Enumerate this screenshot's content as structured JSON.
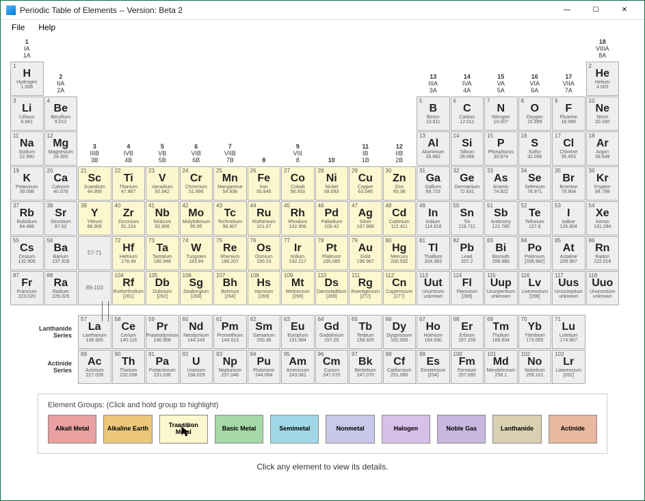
{
  "window": {
    "title": "Periodic Table of Elements  -- Version: Beta 2",
    "min": "—",
    "max": "☐",
    "close": "✕"
  },
  "menu": {
    "file": "File",
    "help": "Help"
  },
  "group_headers": [
    {
      "col": 1,
      "lines": [
        "1",
        "IA",
        "1A"
      ]
    },
    {
      "col": 2,
      "lines": [
        "2",
        "IIA",
        "2A"
      ]
    },
    {
      "col": 3,
      "lines": [
        "3",
        "IIIB",
        "3B"
      ]
    },
    {
      "col": 4,
      "lines": [
        "4",
        "IVB",
        "4B"
      ]
    },
    {
      "col": 5,
      "lines": [
        "5",
        "VB",
        "5B"
      ]
    },
    {
      "col": 6,
      "lines": [
        "6",
        "VIB",
        "6B"
      ]
    },
    {
      "col": 7,
      "lines": [
        "7",
        "VIIB",
        "7B"
      ]
    },
    {
      "col": 8,
      "lines": [
        "8",
        "",
        ""
      ]
    },
    {
      "col": 9,
      "lines": [
        "9",
        "VIII",
        "8"
      ]
    },
    {
      "col": 10,
      "lines": [
        "10",
        "",
        ""
      ]
    },
    {
      "col": 11,
      "lines": [
        "11",
        "IB",
        "1B"
      ]
    },
    {
      "col": 12,
      "lines": [
        "12",
        "IIB",
        "2B"
      ]
    },
    {
      "col": 13,
      "lines": [
        "13",
        "IIIA",
        "3A"
      ]
    },
    {
      "col": 14,
      "lines": [
        "14",
        "IVA",
        "4A"
      ]
    },
    {
      "col": 15,
      "lines": [
        "15",
        "VA",
        "5A"
      ]
    },
    {
      "col": 16,
      "lines": [
        "16",
        "VIA",
        "6A"
      ]
    },
    {
      "col": 17,
      "lines": [
        "17",
        "VIIA",
        "7A"
      ]
    },
    {
      "col": 18,
      "lines": [
        "18",
        "VIIIA",
        "8A"
      ]
    }
  ],
  "elements": [
    {
      "n": 1,
      "s": "H",
      "nm": "Hydrogen",
      "m": "1.008",
      "r": 1,
      "c": 1,
      "g": ""
    },
    {
      "n": 2,
      "s": "He",
      "nm": "Helium",
      "m": "4.003",
      "r": 1,
      "c": 18,
      "g": ""
    },
    {
      "n": 3,
      "s": "Li",
      "nm": "Lithium",
      "m": "6.941",
      "r": 2,
      "c": 1,
      "g": ""
    },
    {
      "n": 4,
      "s": "Be",
      "nm": "Beryllium",
      "m": "9.012",
      "r": 2,
      "c": 2,
      "g": ""
    },
    {
      "n": 5,
      "s": "B",
      "nm": "Boron",
      "m": "10.811",
      "r": 2,
      "c": 13,
      "g": ""
    },
    {
      "n": 6,
      "s": "C",
      "nm": "Carbon",
      "m": "12.011",
      "r": 2,
      "c": 14,
      "g": ""
    },
    {
      "n": 7,
      "s": "N",
      "nm": "Nitrogen",
      "m": "14.007",
      "r": 2,
      "c": 15,
      "g": ""
    },
    {
      "n": 8,
      "s": "O",
      "nm": "Oxygen",
      "m": "15.999",
      "r": 2,
      "c": 16,
      "g": ""
    },
    {
      "n": 9,
      "s": "F",
      "nm": "Fluorine",
      "m": "18.998",
      "r": 2,
      "c": 17,
      "g": ""
    },
    {
      "n": 10,
      "s": "Ne",
      "nm": "Neon",
      "m": "20.180",
      "r": 2,
      "c": 18,
      "g": ""
    },
    {
      "n": 11,
      "s": "Na",
      "nm": "Sodium",
      "m": "22.990",
      "r": 3,
      "c": 1,
      "g": ""
    },
    {
      "n": 12,
      "s": "Mg",
      "nm": "Magnesium",
      "m": "24.305",
      "r": 3,
      "c": 2,
      "g": ""
    },
    {
      "n": 13,
      "s": "Al",
      "nm": "Aluminium",
      "m": "26.982",
      "r": 3,
      "c": 13,
      "g": ""
    },
    {
      "n": 14,
      "s": "Si",
      "nm": "Silicon",
      "m": "28.086",
      "r": 3,
      "c": 14,
      "g": ""
    },
    {
      "n": 15,
      "s": "P",
      "nm": "Phosphorus",
      "m": "30.974",
      "r": 3,
      "c": 15,
      "g": ""
    },
    {
      "n": 16,
      "s": "S",
      "nm": "Sulfur",
      "m": "32.066",
      "r": 3,
      "c": 16,
      "g": ""
    },
    {
      "n": 17,
      "s": "Cl",
      "nm": "Chlorine",
      "m": "35.453",
      "r": 3,
      "c": 17,
      "g": ""
    },
    {
      "n": 18,
      "s": "Ar",
      "nm": "Argon",
      "m": "39.948",
      "r": 3,
      "c": 18,
      "g": ""
    },
    {
      "n": 19,
      "s": "K",
      "nm": "Potassium",
      "m": "39.098",
      "r": 4,
      "c": 1,
      "g": ""
    },
    {
      "n": 20,
      "s": "Ca",
      "nm": "Calcium",
      "m": "40.078",
      "r": 4,
      "c": 2,
      "g": ""
    },
    {
      "n": 21,
      "s": "Sc",
      "nm": "Scandium",
      "m": "44.956",
      "r": 4,
      "c": 3,
      "g": "tm"
    },
    {
      "n": 22,
      "s": "Ti",
      "nm": "Titanium",
      "m": "47.867",
      "r": 4,
      "c": 4,
      "g": "tm"
    },
    {
      "n": 23,
      "s": "V",
      "nm": "Vanadium",
      "m": "50.942",
      "r": 4,
      "c": 5,
      "g": "tm"
    },
    {
      "n": 24,
      "s": "Cr",
      "nm": "Chromium",
      "m": "51.996",
      "r": 4,
      "c": 6,
      "g": "tm"
    },
    {
      "n": 25,
      "s": "Mn",
      "nm": "Manganese",
      "m": "54.938",
      "r": 4,
      "c": 7,
      "g": "tm"
    },
    {
      "n": 26,
      "s": "Fe",
      "nm": "Iron",
      "m": "55.845",
      "r": 4,
      "c": 8,
      "g": "tm"
    },
    {
      "n": 27,
      "s": "Co",
      "nm": "Cobalt",
      "m": "58.933",
      "r": 4,
      "c": 9,
      "g": "tm"
    },
    {
      "n": 28,
      "s": "Ni",
      "nm": "Nickel",
      "m": "58.693",
      "r": 4,
      "c": 10,
      "g": "tm"
    },
    {
      "n": 29,
      "s": "Cu",
      "nm": "Copper",
      "m": "63.546",
      "r": 4,
      "c": 11,
      "g": "tm"
    },
    {
      "n": 30,
      "s": "Zn",
      "nm": "Zinc",
      "m": "65.38",
      "r": 4,
      "c": 12,
      "g": "tm"
    },
    {
      "n": 31,
      "s": "Ga",
      "nm": "Gallium",
      "m": "69.723",
      "r": 4,
      "c": 13,
      "g": ""
    },
    {
      "n": 32,
      "s": "Ge",
      "nm": "Germanium",
      "m": "72.631",
      "r": 4,
      "c": 14,
      "g": ""
    },
    {
      "n": 33,
      "s": "As",
      "nm": "Arsenic",
      "m": "74.922",
      "r": 4,
      "c": 15,
      "g": ""
    },
    {
      "n": 34,
      "s": "Se",
      "nm": "Selenium",
      "m": "78.971",
      "r": 4,
      "c": 16,
      "g": ""
    },
    {
      "n": 35,
      "s": "Br",
      "nm": "Bromine",
      "m": "79.904",
      "r": 4,
      "c": 17,
      "g": ""
    },
    {
      "n": 36,
      "s": "Kr",
      "nm": "Krypton",
      "m": "84.798",
      "r": 4,
      "c": 18,
      "g": ""
    },
    {
      "n": 37,
      "s": "Rb",
      "nm": "Rubidium",
      "m": "84.468",
      "r": 5,
      "c": 1,
      "g": ""
    },
    {
      "n": 38,
      "s": "Sr",
      "nm": "Strontium",
      "m": "87.62",
      "r": 5,
      "c": 2,
      "g": ""
    },
    {
      "n": 39,
      "s": "Y",
      "nm": "Yttrium",
      "m": "88.906",
      "r": 5,
      "c": 3,
      "g": "tm"
    },
    {
      "n": 40,
      "s": "Zr",
      "nm": "Zirconium",
      "m": "91.224",
      "r": 5,
      "c": 4,
      "g": "tm"
    },
    {
      "n": 41,
      "s": "Nb",
      "nm": "Niobium",
      "m": "92.906",
      "r": 5,
      "c": 5,
      "g": "tm"
    },
    {
      "n": 42,
      "s": "Mo",
      "nm": "Molybdenum",
      "m": "95.95",
      "r": 5,
      "c": 6,
      "g": "tm"
    },
    {
      "n": 43,
      "s": "Tc",
      "nm": "Technetium",
      "m": "98.907",
      "r": 5,
      "c": 7,
      "g": "tm"
    },
    {
      "n": 44,
      "s": "Ru",
      "nm": "Ruthenium",
      "m": "101.07",
      "r": 5,
      "c": 8,
      "g": "tm"
    },
    {
      "n": 45,
      "s": "Rh",
      "nm": "Rhodium",
      "m": "102.906",
      "r": 5,
      "c": 9,
      "g": "tm"
    },
    {
      "n": 46,
      "s": "Pd",
      "nm": "Palladium",
      "m": "106.42",
      "r": 5,
      "c": 10,
      "g": "tm"
    },
    {
      "n": 47,
      "s": "Ag",
      "nm": "Silver",
      "m": "107.868",
      "r": 5,
      "c": 11,
      "g": "tm"
    },
    {
      "n": 48,
      "s": "Cd",
      "nm": "Cadmium",
      "m": "112.411",
      "r": 5,
      "c": 12,
      "g": "tm"
    },
    {
      "n": 49,
      "s": "In",
      "nm": "Indium",
      "m": "114.818",
      "r": 5,
      "c": 13,
      "g": ""
    },
    {
      "n": 50,
      "s": "Sn",
      "nm": "Tin",
      "m": "118.711",
      "r": 5,
      "c": 14,
      "g": ""
    },
    {
      "n": 51,
      "s": "Sb",
      "nm": "Antimony",
      "m": "121.760",
      "r": 5,
      "c": 15,
      "g": ""
    },
    {
      "n": 52,
      "s": "Te",
      "nm": "Tellurium",
      "m": "127.6",
      "r": 5,
      "c": 16,
      "g": ""
    },
    {
      "n": 53,
      "s": "I",
      "nm": "Iodine",
      "m": "126.904",
      "r": 5,
      "c": 17,
      "g": ""
    },
    {
      "n": 54,
      "s": "Xe",
      "nm": "Xenon",
      "m": "131.294",
      "r": 5,
      "c": 18,
      "g": ""
    },
    {
      "n": 55,
      "s": "Cs",
      "nm": "Cesium",
      "m": "132.905",
      "r": 6,
      "c": 1,
      "g": ""
    },
    {
      "n": 56,
      "s": "Ba",
      "nm": "Barium",
      "m": "137.328",
      "r": 6,
      "c": 2,
      "g": ""
    },
    {
      "n": 72,
      "s": "Hf",
      "nm": "Hafnium",
      "m": "178.49",
      "r": 6,
      "c": 4,
      "g": "tm"
    },
    {
      "n": 73,
      "s": "Ta",
      "nm": "Tantalum",
      "m": "180.948",
      "r": 6,
      "c": 5,
      "g": "tm"
    },
    {
      "n": 74,
      "s": "W",
      "nm": "Tungsten",
      "m": "183.84",
      "r": 6,
      "c": 6,
      "g": "tm"
    },
    {
      "n": 75,
      "s": "Re",
      "nm": "Rhenium",
      "m": "186.207",
      "r": 6,
      "c": 7,
      "g": "tm"
    },
    {
      "n": 76,
      "s": "Os",
      "nm": "Osmium",
      "m": "190.23",
      "r": 6,
      "c": 8,
      "g": "tm"
    },
    {
      "n": 77,
      "s": "Ir",
      "nm": "Iridium",
      "m": "192.217",
      "r": 6,
      "c": 9,
      "g": "tm"
    },
    {
      "n": 78,
      "s": "Pt",
      "nm": "Platinum",
      "m": "195.085",
      "r": 6,
      "c": 10,
      "g": "tm"
    },
    {
      "n": 79,
      "s": "Au",
      "nm": "Gold",
      "m": "196.967",
      "r": 6,
      "c": 11,
      "g": "tm"
    },
    {
      "n": 80,
      "s": "Hg",
      "nm": "Mercury",
      "m": "200.592",
      "r": 6,
      "c": 12,
      "g": "tm"
    },
    {
      "n": 81,
      "s": "Tl",
      "nm": "Thallium",
      "m": "204.383",
      "r": 6,
      "c": 13,
      "g": ""
    },
    {
      "n": 82,
      "s": "Pb",
      "nm": "Lead",
      "m": "207.2",
      "r": 6,
      "c": 14,
      "g": ""
    },
    {
      "n": 83,
      "s": "Bi",
      "nm": "Bismuth",
      "m": "208.980",
      "r": 6,
      "c": 15,
      "g": ""
    },
    {
      "n": 84,
      "s": "Po",
      "nm": "Polonium",
      "m": "[208.982]",
      "r": 6,
      "c": 16,
      "g": ""
    },
    {
      "n": 85,
      "s": "At",
      "nm": "Astatine",
      "m": "209.987",
      "r": 6,
      "c": 17,
      "g": ""
    },
    {
      "n": 86,
      "s": "Rn",
      "nm": "Radon",
      "m": "222.018",
      "r": 6,
      "c": 18,
      "g": ""
    },
    {
      "n": 87,
      "s": "Fr",
      "nm": "Francium",
      "m": "223.020",
      "r": 7,
      "c": 1,
      "g": ""
    },
    {
      "n": 88,
      "s": "Ra",
      "nm": "Radium",
      "m": "226.025",
      "r": 7,
      "c": 2,
      "g": ""
    },
    {
      "n": 104,
      "s": "Rf",
      "nm": "Rutherfordium",
      "m": "[261]",
      "r": 7,
      "c": 4,
      "g": "tm"
    },
    {
      "n": 105,
      "s": "Db",
      "nm": "Dubnium",
      "m": "[262]",
      "r": 7,
      "c": 5,
      "g": "tm"
    },
    {
      "n": 106,
      "s": "Sg",
      "nm": "Seaborgium",
      "m": "[266]",
      "r": 7,
      "c": 6,
      "g": "tm"
    },
    {
      "n": 107,
      "s": "Bh",
      "nm": "Bohrium",
      "m": "[264]",
      "r": 7,
      "c": 7,
      "g": "tm"
    },
    {
      "n": 108,
      "s": "Hs",
      "nm": "Hassium",
      "m": "[269]",
      "r": 7,
      "c": 8,
      "g": "tm"
    },
    {
      "n": 109,
      "s": "Mt",
      "nm": "Meitnerium",
      "m": "[268]",
      "r": 7,
      "c": 9,
      "g": "tm"
    },
    {
      "n": 110,
      "s": "Ds",
      "nm": "Darmstadtium",
      "m": "[269]",
      "r": 7,
      "c": 10,
      "g": "tm"
    },
    {
      "n": 111,
      "s": "Rg",
      "nm": "Roentgenium",
      "m": "[272]",
      "r": 7,
      "c": 11,
      "g": "tm"
    },
    {
      "n": 112,
      "s": "Cn",
      "nm": "Copernicium",
      "m": "[277]",
      "r": 7,
      "c": 12,
      "g": "tm"
    },
    {
      "n": 113,
      "s": "Uut",
      "nm": "Ununtrium",
      "m": "unknown",
      "r": 7,
      "c": 13,
      "g": ""
    },
    {
      "n": 114,
      "s": "Fl",
      "nm": "Flerovium",
      "m": "[289]",
      "r": 7,
      "c": 14,
      "g": ""
    },
    {
      "n": 115,
      "s": "Uup",
      "nm": "Ununpentium",
      "m": "unknown",
      "r": 7,
      "c": 15,
      "g": ""
    },
    {
      "n": 116,
      "s": "Lv",
      "nm": "Livermorium",
      "m": "[298]",
      "r": 7,
      "c": 16,
      "g": ""
    },
    {
      "n": 117,
      "s": "Uus",
      "nm": "Ununseptium",
      "m": "unknown",
      "r": 7,
      "c": 17,
      "g": ""
    },
    {
      "n": 118,
      "s": "Uuo",
      "nm": "Ununoctium",
      "m": "unknown",
      "r": 7,
      "c": 18,
      "g": ""
    }
  ],
  "placeholders": [
    {
      "r": 6,
      "c": 3,
      "label": "57-71"
    },
    {
      "r": 7,
      "c": 3,
      "label": "89-103"
    }
  ],
  "lanthanides": [
    {
      "n": 57,
      "s": "La",
      "nm": "Lanthanum",
      "m": "138.905"
    },
    {
      "n": 58,
      "s": "Ce",
      "nm": "Cerium",
      "m": "140.116"
    },
    {
      "n": 59,
      "s": "Pr",
      "nm": "Praseodymium",
      "m": "140.908"
    },
    {
      "n": 60,
      "s": "Nd",
      "nm": "Neodymium",
      "m": "144.243"
    },
    {
      "n": 61,
      "s": "Pm",
      "nm": "Promethium",
      "m": "144.913"
    },
    {
      "n": 62,
      "s": "Sm",
      "nm": "Samarium",
      "m": "150.36"
    },
    {
      "n": 63,
      "s": "Eu",
      "nm": "Europium",
      "m": "151.964"
    },
    {
      "n": 64,
      "s": "Gd",
      "nm": "Gadolinium",
      "m": "157.25"
    },
    {
      "n": 65,
      "s": "Tb",
      "nm": "Terbium",
      "m": "158.925"
    },
    {
      "n": 66,
      "s": "Dy",
      "nm": "Dysprosium",
      "m": "162.500"
    },
    {
      "n": 67,
      "s": "Ho",
      "nm": "Holmium",
      "m": "164.930"
    },
    {
      "n": 68,
      "s": "Er",
      "nm": "Erbium",
      "m": "167.259"
    },
    {
      "n": 69,
      "s": "Tm",
      "nm": "Thulium",
      "m": "168.934"
    },
    {
      "n": 70,
      "s": "Yb",
      "nm": "Ytterbium",
      "m": "173.055"
    },
    {
      "n": 71,
      "s": "Lu",
      "nm": "Lutetium",
      "m": "174.967"
    }
  ],
  "actinides": [
    {
      "n": 89,
      "s": "Ac",
      "nm": "Actinium",
      "m": "227.028"
    },
    {
      "n": 90,
      "s": "Th",
      "nm": "Thorium",
      "m": "232.038"
    },
    {
      "n": 91,
      "s": "Pa",
      "nm": "Protactinium",
      "m": "231.036"
    },
    {
      "n": 92,
      "s": "U",
      "nm": "Uranium",
      "m": "238.029"
    },
    {
      "n": 93,
      "s": "Np",
      "nm": "Neptunium",
      "m": "237.048"
    },
    {
      "n": 94,
      "s": "Pu",
      "nm": "Plutonium",
      "m": "244.064"
    },
    {
      "n": 95,
      "s": "Am",
      "nm": "Americium",
      "m": "243.061"
    },
    {
      "n": 96,
      "s": "Cm",
      "nm": "Curium",
      "m": "247.070"
    },
    {
      "n": 97,
      "s": "Bk",
      "nm": "Berkelium",
      "m": "247.070"
    },
    {
      "n": 98,
      "s": "Cf",
      "nm": "Californium",
      "m": "251.080"
    },
    {
      "n": 99,
      "s": "Es",
      "nm": "Einsteinium",
      "m": "[254]"
    },
    {
      "n": 100,
      "s": "Fm",
      "nm": "Fermium",
      "m": "257.095"
    },
    {
      "n": 101,
      "s": "Md",
      "nm": "Mendelevium",
      "m": "258.1"
    },
    {
      "n": 102,
      "s": "No",
      "nm": "Nobelium",
      "m": "259.101"
    },
    {
      "n": 103,
      "s": "Lr",
      "nm": "Lawrencium",
      "m": "[262]"
    }
  ],
  "series_labels": {
    "lan": "Lanthanide\nSeries",
    "act": "Actinide\nSeries"
  },
  "groups": {
    "label": "Element Groups:  (Click and hold group to highlight)",
    "buttons": [
      {
        "label": "Alkali Metal",
        "cls": "c0"
      },
      {
        "label": "Alkaline Earth",
        "cls": "c1"
      },
      {
        "label": "Transition Metal",
        "cls": "c2"
      },
      {
        "label": "Basic Metal",
        "cls": "c3"
      },
      {
        "label": "Semimetal",
        "cls": "c4"
      },
      {
        "label": "Nonmetal",
        "cls": "c5"
      },
      {
        "label": "Halogen",
        "cls": "c6"
      },
      {
        "label": "Noble Gas",
        "cls": "c7"
      },
      {
        "label": "Lanthanide",
        "cls": "c8"
      },
      {
        "label": "Actinide",
        "cls": "c9"
      }
    ]
  },
  "footer": "Click any element to view its details."
}
